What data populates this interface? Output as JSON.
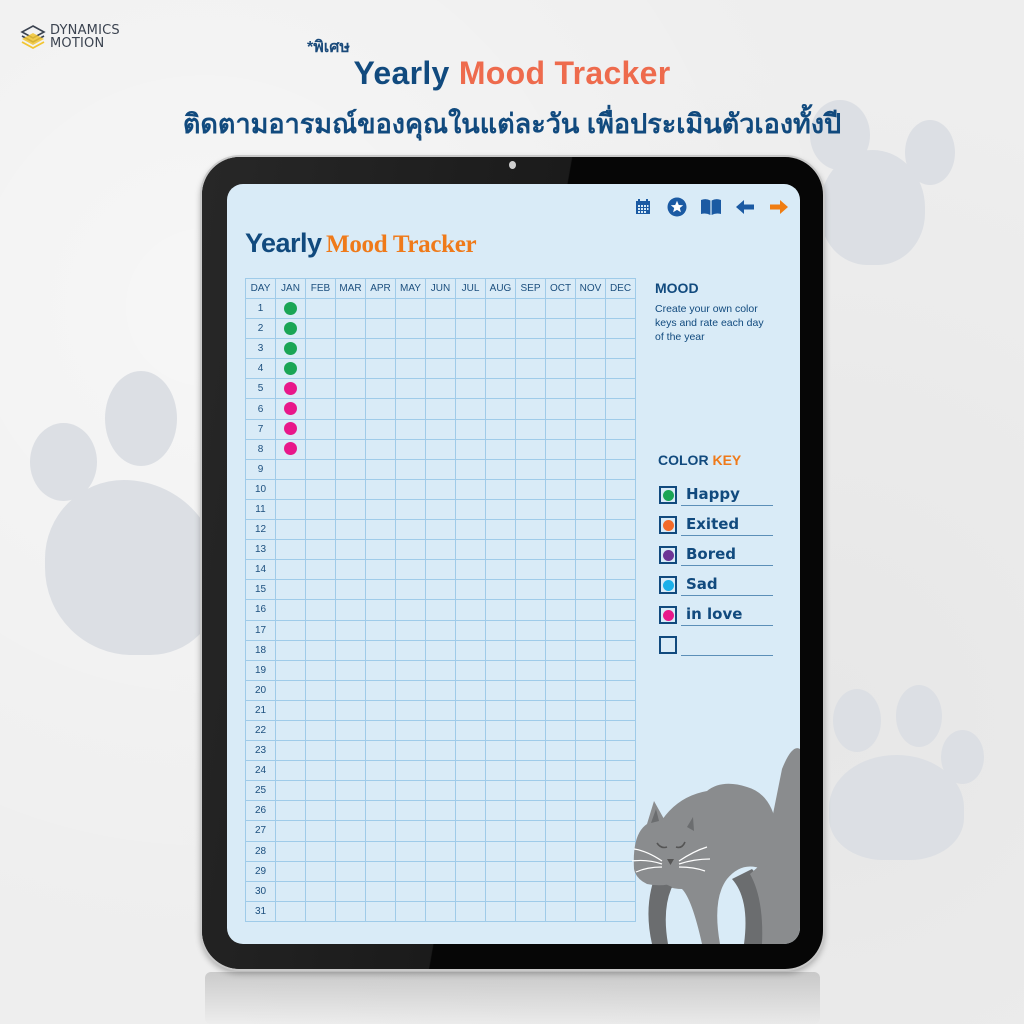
{
  "brand": {
    "logo_line1": "DYNAMICS",
    "logo_line2": "MOTION",
    "logo_icon": "stacked-layers-logo-icon"
  },
  "promo": {
    "special_label": "*พิเศษ",
    "headline_part1": "Yearly",
    "headline_part2": "Mood Tracker",
    "subheadline": "ติดตามอารมณ์ของคุณในแต่ละวัน เพื่อประเมินตัวเองทั้งปี"
  },
  "toolbar": {
    "icons": [
      "calendar-icon",
      "star-icon",
      "book-icon",
      "arrow-left-icon",
      "arrow-right-icon"
    ]
  },
  "page": {
    "title_part1": "Yearly",
    "title_part2": "Mood Tracker"
  },
  "grid": {
    "day_header": "DAY",
    "months": [
      "JAN",
      "FEB",
      "MAR",
      "APR",
      "MAY",
      "JUN",
      "JUL",
      "AUG",
      "SEP",
      "OCT",
      "NOV",
      "DEC"
    ],
    "days": 31,
    "entries": {
      "JAN": [
        "Happy",
        "Happy",
        "Happy",
        "Happy",
        "in love",
        "in love",
        "in love",
        "in love"
      ]
    }
  },
  "mood_panel": {
    "title": "MOOD",
    "description": "Create your own color keys and rate each day of the year"
  },
  "color_key": {
    "title_part1": "COLOR",
    "title_part2": "KEY",
    "items": [
      {
        "label": "Happy",
        "color": "#1aa555"
      },
      {
        "label": "Exited",
        "color": "#f26a2a"
      },
      {
        "label": "Bored",
        "color": "#6d3596"
      },
      {
        "label": "Sad",
        "color": "#1ab0ea"
      },
      {
        "label": "in love",
        "color": "#e8178a"
      },
      {
        "label": "",
        "color": null
      }
    ]
  },
  "colors": {
    "navy": "#114a7e",
    "orange": "#ef7a1a",
    "coral": "#ee6b4d",
    "screen_bg": "#d9ebf7",
    "grid_line": "#9fcbe9"
  }
}
